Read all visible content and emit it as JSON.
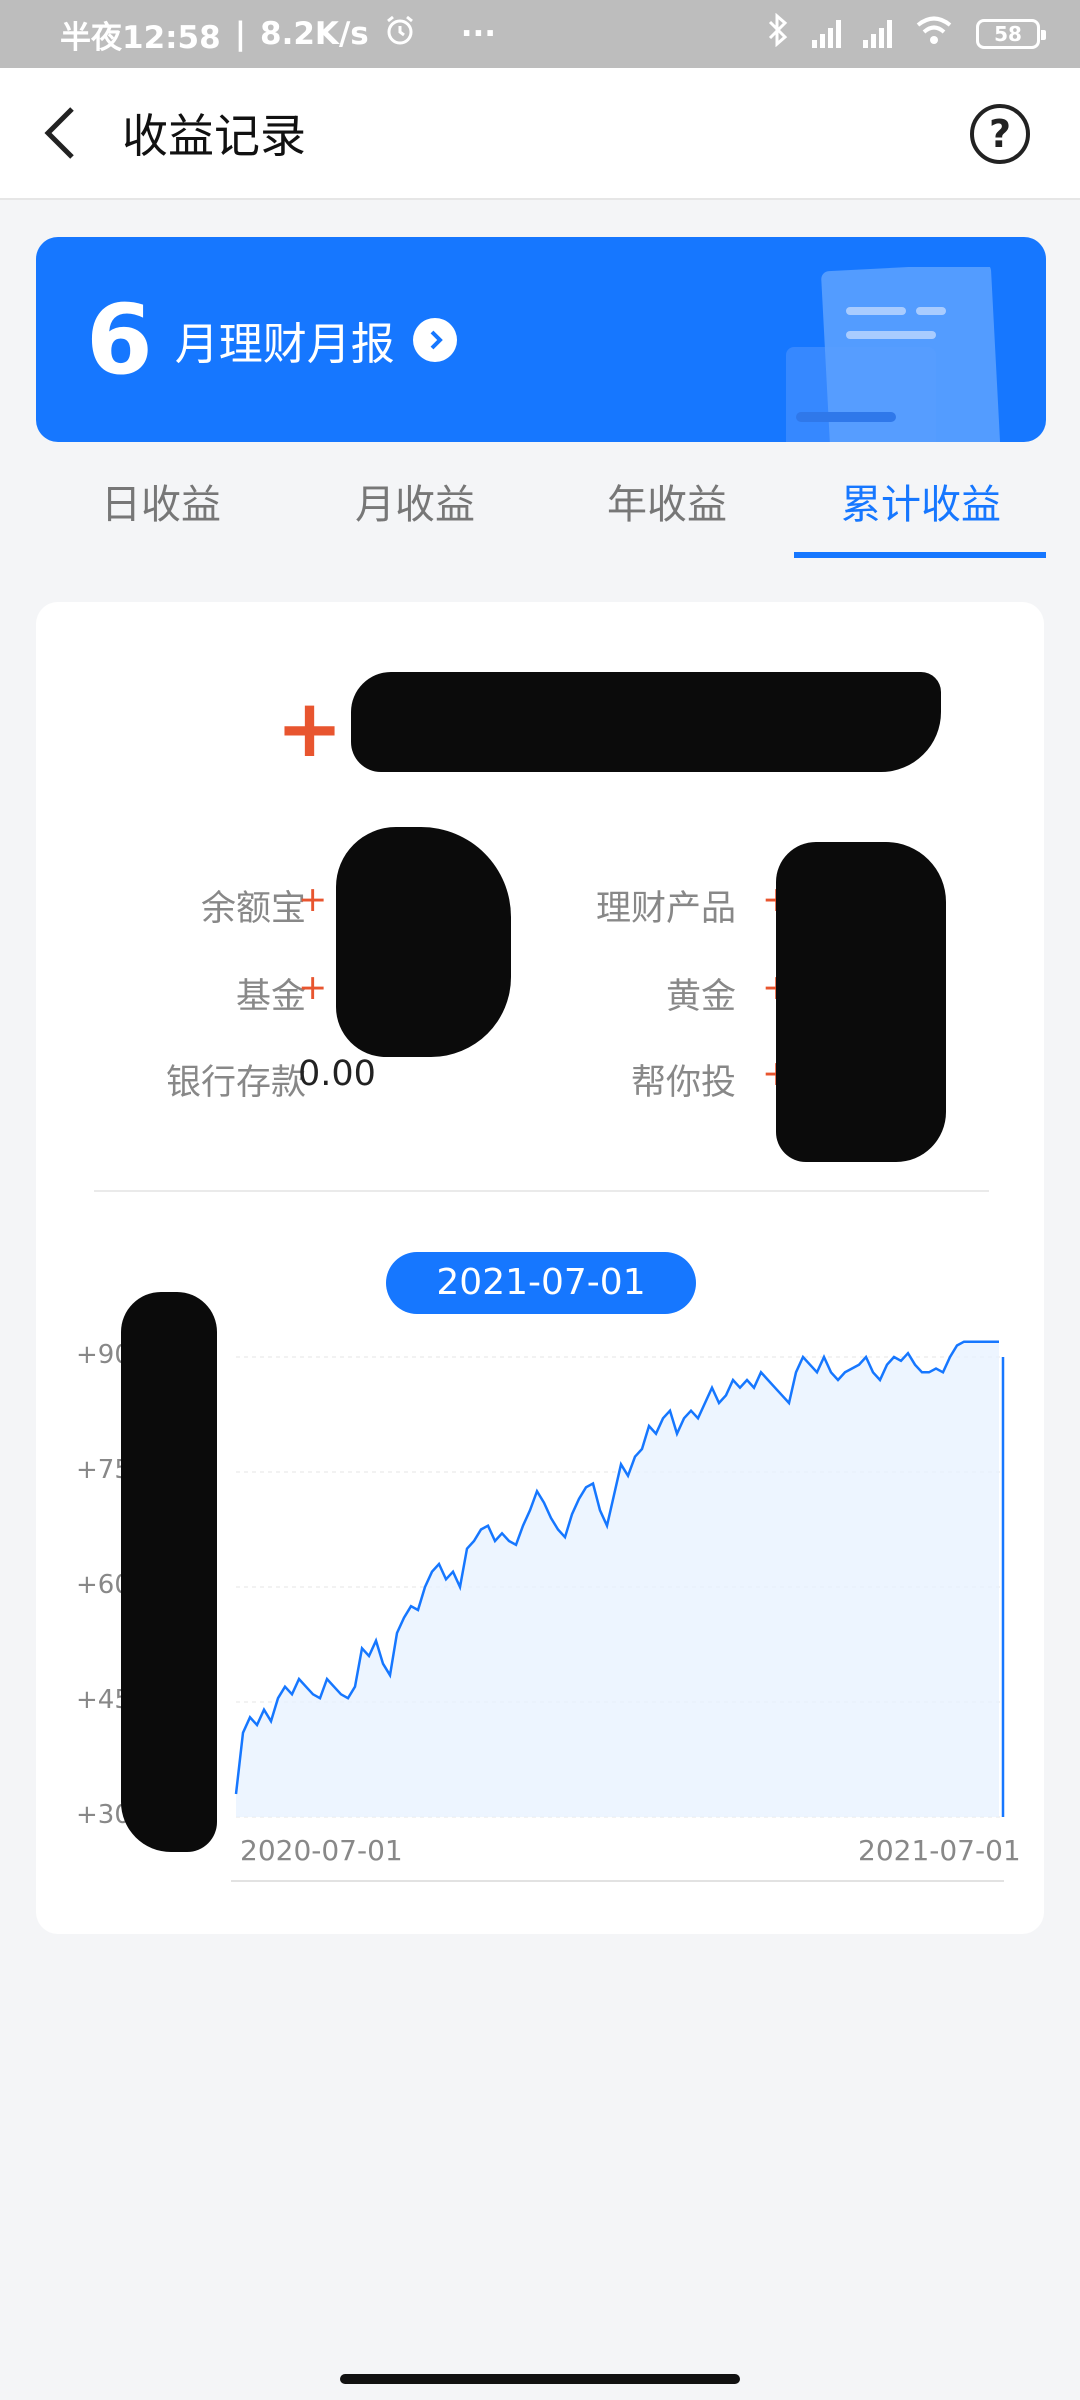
{
  "status_bar": {
    "time": "半夜12:58",
    "network_speed": "8.2K/s",
    "dots": "···",
    "battery": "58"
  },
  "nav": {
    "title": "收益记录",
    "help_symbol": "?"
  },
  "banner": {
    "month_number": "6",
    "text": "月理财月报"
  },
  "tabs": [
    {
      "label": "日收益",
      "active": false
    },
    {
      "label": "月收益",
      "active": false
    },
    {
      "label": "年收益",
      "active": false
    },
    {
      "label": "累计收益",
      "active": true
    }
  ],
  "summary": {
    "total_prefix": "+",
    "items": [
      {
        "label": "余额宝",
        "value": "+"
      },
      {
        "label": "理财产品",
        "value": "+"
      },
      {
        "label": "基金",
        "value": "+"
      },
      {
        "label": "黄金",
        "value": "+"
      },
      {
        "label": "银行存款",
        "value": "0.00"
      },
      {
        "label": "帮你投",
        "value": "+"
      }
    ]
  },
  "chart_data": {
    "type": "area",
    "selected_date": "2021-07-01",
    "x_start_label": "2020-07-01",
    "x_end_label": "2021-07-01",
    "y_tick_labels": [
      "+900",
      "+750",
      "+600",
      "+450",
      "+300"
    ],
    "y_ticks": [
      900,
      750,
      600,
      450,
      300
    ],
    "ylim": [
      300,
      900
    ],
    "grid": true,
    "color": "#1677ff",
    "values": [
      330,
      410,
      430,
      420,
      440,
      425,
      455,
      470,
      460,
      480,
      470,
      460,
      455,
      480,
      470,
      460,
      455,
      470,
      520,
      510,
      530,
      500,
      485,
      540,
      560,
      575,
      570,
      600,
      620,
      630,
      610,
      620,
      600,
      650,
      660,
      675,
      680,
      660,
      670,
      660,
      655,
      680,
      700,
      725,
      710,
      690,
      675,
      665,
      695,
      715,
      730,
      735,
      700,
      680,
      720,
      760,
      745,
      770,
      780,
      810,
      800,
      820,
      830,
      800,
      820,
      830,
      820,
      840,
      860,
      840,
      850,
      870,
      860,
      870,
      860,
      880,
      870,
      860,
      850,
      840,
      880,
      900,
      890,
      880,
      900,
      880,
      870,
      880,
      885,
      890,
      900,
      880,
      870,
      890,
      900,
      895,
      905,
      890,
      880,
      880,
      885,
      880,
      900,
      915,
      920,
      925,
      930,
      920,
      940,
      960
    ]
  }
}
